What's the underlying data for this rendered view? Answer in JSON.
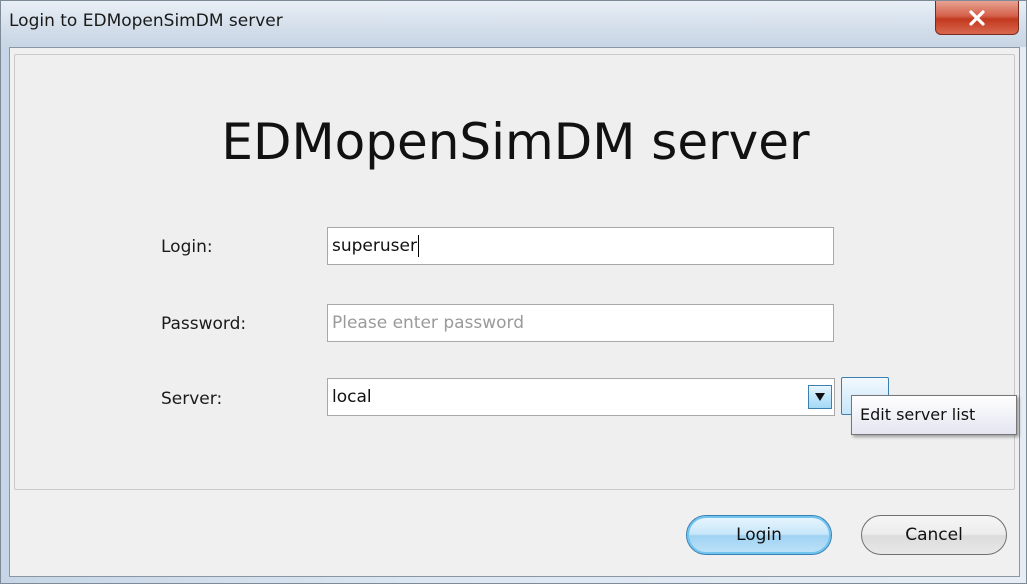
{
  "window": {
    "title": "Login to EDMopenSimDM server",
    "close_symbol": "x"
  },
  "form": {
    "heading": "EDMopenSimDM server",
    "login_label": "Login:",
    "login_value": "superuser",
    "password_label": "Password:",
    "password_placeholder": "Please enter password",
    "password_value": "",
    "server_label": "Server:",
    "server_selected": "local",
    "edit_server_button": "...",
    "edit_server_tooltip": "Edit server list"
  },
  "buttons": {
    "login": "Login",
    "cancel": "Cancel"
  },
  "icons": {
    "close": "close-icon",
    "dropdown": "chevron-down-icon"
  },
  "colors": {
    "close_button": "#c2391f",
    "focus_border": "#3c7fb1",
    "client_bg": "#f0f0f0"
  }
}
